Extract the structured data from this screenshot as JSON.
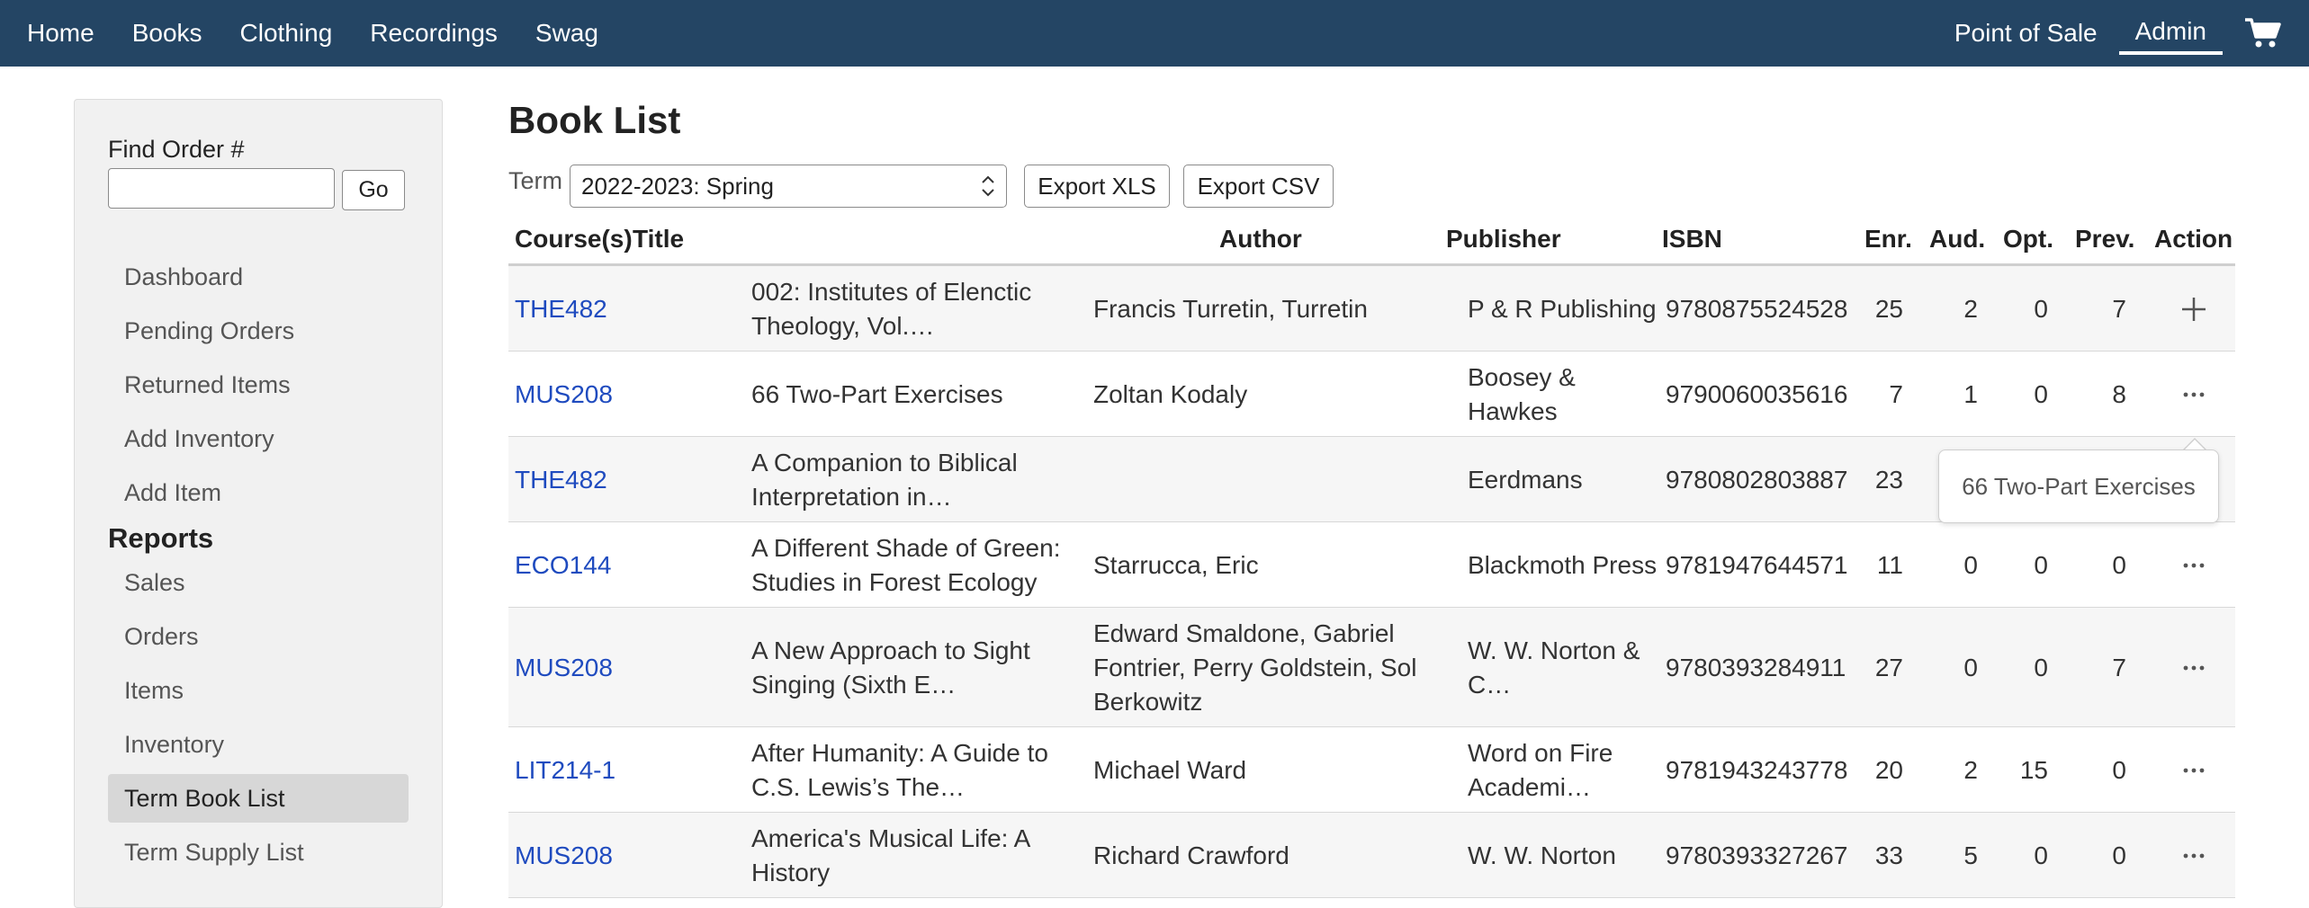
{
  "nav": {
    "left": [
      "Home",
      "Books",
      "Clothing",
      "Recordings",
      "Swag"
    ],
    "point_of_sale": "Point of Sale",
    "admin": "Admin",
    "cart_icon": "shopping-cart-icon"
  },
  "sidebar": {
    "find_order_label": "Find Order #",
    "find_order_value": "",
    "go_label": "Go",
    "links": [
      "Dashboard",
      "Pending Orders",
      "Returned Items",
      "Add Inventory",
      "Add Item"
    ],
    "reports_heading": "Reports",
    "report_links": [
      "Sales",
      "Orders",
      "Items",
      "Inventory",
      "Term Book List",
      "Term Supply List"
    ],
    "active_link": "Term Book List"
  },
  "main": {
    "title": "Book List",
    "term_label": "Term",
    "term_value": "2022-2023: Spring",
    "export_xls": "Export XLS",
    "export_csv": "Export CSV"
  },
  "table": {
    "headers": {
      "course": "Course(s)",
      "title": "Title",
      "author": "Author",
      "publisher": "Publisher",
      "isbn": "ISBN",
      "enr": "Enr.",
      "aud": "Aud.",
      "opt": "Opt.",
      "prev": "Prev.",
      "action": "Action"
    },
    "rows": [
      {
        "course": "THE482",
        "title": [
          "002: Institutes of Elenctic",
          "Theology, Vol.…"
        ],
        "author": [
          "Francis Turretin, Turretin"
        ],
        "publisher": [
          "P & R Publishing"
        ],
        "isbn": "9780875524528",
        "enr": "25",
        "aud": "2",
        "opt": "0",
        "prev": "7",
        "action": "plus"
      },
      {
        "course": "MUS208",
        "title": [
          "66 Two-Part Exercises"
        ],
        "author": [
          "Zoltan Kodaly"
        ],
        "publisher": [
          "Boosey &",
          "Hawkes"
        ],
        "isbn": "9790060035616",
        "enr": "7",
        "aud": "1",
        "opt": "0",
        "prev": "8",
        "action": "dots"
      },
      {
        "course": "THE482",
        "title": [
          "A Companion to Biblical",
          "Interpretation in…"
        ],
        "author": [],
        "publisher": [
          "Eerdmans"
        ],
        "isbn": "9780802803887",
        "enr": "23",
        "aud": "",
        "opt": "",
        "prev": "",
        "action": ""
      },
      {
        "course": "ECO144",
        "title": [
          "A Different Shade of Green:",
          "Studies in Forest Ecology"
        ],
        "author": [
          "Starrucca, Eric"
        ],
        "publisher": [
          "Blackmoth Press"
        ],
        "isbn": "9781947644571",
        "enr": "11",
        "aud": "0",
        "opt": "0",
        "prev": "0",
        "action": "dots"
      },
      {
        "course": "MUS208",
        "title": [
          "A New Approach to Sight",
          "Singing (Sixth E…"
        ],
        "author": [
          "Edward Smaldone, Gabriel",
          "Fontrier, Perry Goldstein, Sol",
          "Berkowitz"
        ],
        "publisher": [
          "W. W. Norton &",
          "C…"
        ],
        "isbn": "9780393284911",
        "enr": "27",
        "aud": "0",
        "opt": "0",
        "prev": "7",
        "action": "dots"
      },
      {
        "course": "LIT214-1",
        "title": [
          "After Humanity: A Guide to",
          "C.S. Lewis’s The…"
        ],
        "author": [
          "Michael Ward"
        ],
        "publisher": [
          "Word on Fire",
          "Academi…"
        ],
        "isbn": "9781943243778",
        "enr": "20",
        "aud": "2",
        "opt": "15",
        "prev": "0",
        "action": "dots"
      },
      {
        "course": "MUS208",
        "title": [
          "America's Musical Life: A",
          "History"
        ],
        "author": [
          "Richard Crawford"
        ],
        "publisher": [
          "W. W. Norton"
        ],
        "isbn": "9780393327267",
        "enr": "33",
        "aud": "5",
        "opt": "0",
        "prev": "0",
        "action": "dots"
      }
    ]
  },
  "tooltip": {
    "text": "66 Two-Part Exercises"
  }
}
